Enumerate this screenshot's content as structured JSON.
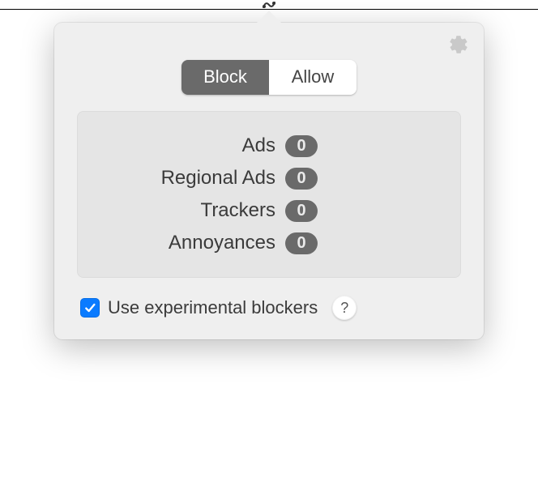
{
  "segmented": {
    "block": "Block",
    "allow": "Allow",
    "active": "block"
  },
  "stats": [
    {
      "label": "Ads",
      "count": 0
    },
    {
      "label": "Regional Ads",
      "count": 0
    },
    {
      "label": "Trackers",
      "count": 0
    },
    {
      "label": "Annoyances",
      "count": 0
    }
  ],
  "footer": {
    "checkbox_checked": true,
    "label": "Use experimental blockers",
    "help": "?"
  },
  "icons": {
    "gear": "gear-icon",
    "topbar": "extension-icon"
  }
}
